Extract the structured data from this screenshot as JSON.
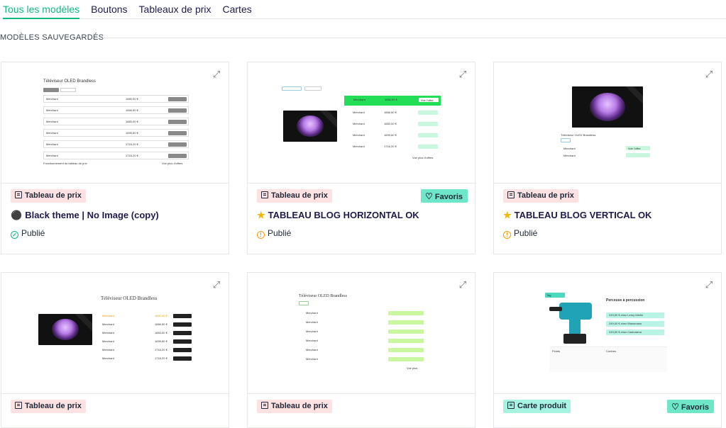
{
  "tabs": [
    {
      "label": "Tous les modèles",
      "active": true
    },
    {
      "label": "Boutons",
      "active": false
    },
    {
      "label": "Tableaux de prix",
      "active": false
    },
    {
      "label": "Cartes",
      "active": false
    }
  ],
  "section_title": "MODÈLES SAUVEGARDÉS",
  "cards": [
    {
      "badge": "Tableau de prix",
      "title": "Black theme | No Image (copy)",
      "title_icon": "black-circle-icon",
      "status": "Publié",
      "status_icon": "check-circle-icon",
      "favorite": false
    },
    {
      "badge": "Tableau de prix",
      "title": "TABLEAU BLOG HORIZONTAL OK",
      "title_icon": "star-icon",
      "status": "Publié",
      "status_icon": "warning-circle-icon",
      "favorite": true,
      "favorite_label": "Favoris"
    },
    {
      "badge": "Tableau de prix",
      "title": "TABLEAU BLOG VERTICAL OK",
      "title_icon": "star-icon",
      "status": "Publié",
      "status_icon": "warning-circle-icon",
      "favorite": false
    },
    {
      "badge": "Tableau de prix",
      "favorite": false
    },
    {
      "badge": "Tableau de prix",
      "favorite": false
    },
    {
      "badge": "Carte produit",
      "favorite": true,
      "favorite_label": "Favoris"
    }
  ],
  "previews": {
    "p1": {
      "title": "Téléviseur OLED Brandless",
      "rows": [
        "Merchant",
        "Merchant",
        "Merchant",
        "Merchant",
        "Merchant",
        "Merchant"
      ],
      "prices": [
        "1680,00 €",
        "1666,50 €",
        "1683,00 €",
        "1699,60 €",
        "1716,20 €",
        "1716,20 €"
      ],
      "footer_left": "Fonctionnement du tableau de prix",
      "footer_right": "Voir plus d'offres"
    },
    "p2": {
      "rows": [
        "Merchant",
        "Merchant",
        "Merchant",
        "Merchant",
        "Merchant"
      ],
      "prices": [
        "1650,00 €",
        "1666,50 €",
        "1683,00 €",
        "1699,60 €",
        "1716,20 €"
      ],
      "button": "Voir l'offre",
      "footer_right": "Voir plus d'offres"
    },
    "p3": {
      "title": "Téléviseur OLED Brandless",
      "button": "Voir l'offre"
    },
    "p4": {
      "title": "Téléviseur OLED Brandless",
      "rows": [
        "Merchant",
        "Merchant",
        "Merchant",
        "Merchant",
        "Merchant",
        "Merchant"
      ],
      "prices": [
        "1650,00 €",
        "1666,50 €",
        "1683,00 €",
        "1699,60 €",
        "1716,20 €",
        "1716,20 €"
      ],
      "button": "Voir l'offre"
    },
    "p5": {
      "title": "Téléviseur OLED Brandless",
      "rows": [
        "Merchant",
        "Merchant",
        "Merchant",
        "Merchant",
        "Merchant",
        "Merchant"
      ],
      "button": "Voir l'offre",
      "footer_right": "Voir plus"
    },
    "p6": {
      "title": "Perceuse à percussion",
      "tag": "Tag",
      "offers": [
        "249,00 € chez Leroy Merlin",
        "249,00 € chez Manomano",
        "249,00 € chez Castorama"
      ],
      "col1": "Points",
      "col2": "Contres"
    }
  }
}
